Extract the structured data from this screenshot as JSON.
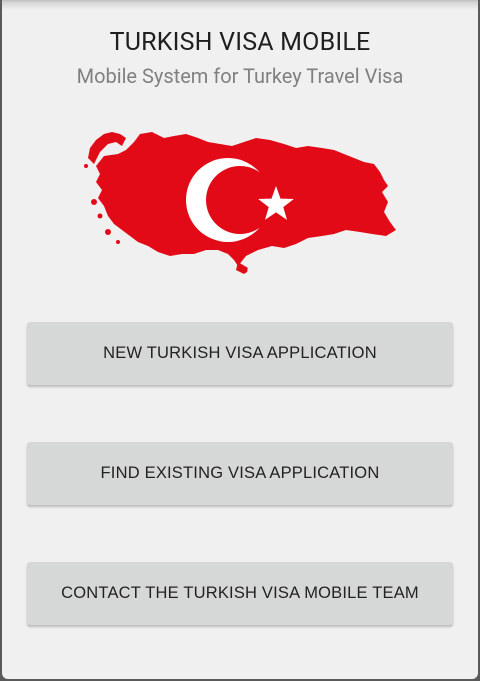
{
  "header": {
    "title": "TURKISH VISA MOBILE",
    "subtitle": "Mobile System for Turkey Travel Visa"
  },
  "hero": {
    "icon": "turkey-flag-map-icon",
    "map_color": "#e30a17",
    "symbol_color": "#ffffff"
  },
  "actions": {
    "new_application_label": "NEW TURKISH VISA APPLICATION",
    "find_application_label": "FIND EXISTING VISA APPLICATION",
    "contact_team_label": "CONTACT THE TURKISH VISA MOBILE TEAM"
  },
  "colors": {
    "background": "#f0f0f0",
    "button": "#d6d7d7",
    "title_text": "#1f1f1f",
    "subtitle_text": "#808080"
  }
}
